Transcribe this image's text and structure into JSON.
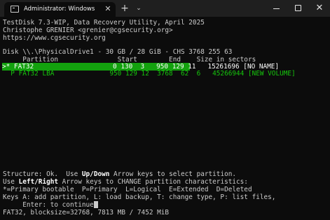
{
  "window": {
    "tab_title": "Administrator: Windows Pow",
    "tab_close": "✕",
    "new_tab": "+",
    "dropdown": "⌄",
    "minimize": "",
    "maximize": "",
    "close": "✕"
  },
  "terminal": {
    "header_1": "TestDisk 7.3-WIP, Data Recovery Utility, April 2025",
    "header_2": "Christophe GRENIER <grenier@cgsecurity.org>",
    "header_3": "https://www.cgsecurity.org",
    "disk_line": "Disk \\\\.\\PhysicalDrive1 - 30 GB / 28 GiB - CHS 3768 255 63",
    "columns_line": "     Partition               Start        End    Size in sectors",
    "partitions": [
      {
        "text": ">* FAT32                    0 130  3   950 129 11   15261696 [NO NAME]",
        "selected": true
      },
      {
        "text": "  P FAT32 LBA              950 129 12  3768  62  6   45266944 [NEW VOLUME]",
        "selected": false
      }
    ],
    "help_1_a": "Structure: Ok.  Use ",
    "help_1_b": "Up/Down",
    "help_1_c": " Arrow keys to select partition.",
    "help_2_a": "Use ",
    "help_2_b": "Left/Right",
    "help_2_c": " Arrow keys to CHANGE partition characteristics:",
    "help_3": "*=Primary bootable  P=Primary  L=Logical  E=Extended  D=Deleted",
    "help_4": "Keys A: add partition, L: load backup, T: change type, P: list files,",
    "help_5": "     Enter: to continue",
    "status_line": "FAT32, blocksize=32768, 7813 MB / 7452 MiB"
  },
  "colors": {
    "background": "#0c0c0c",
    "text": "#cccccc",
    "highlight_bg": "#13a10e",
    "highlight_fg": "#ffffff",
    "green_text": "#16c60c",
    "titlebar": "#1f1f1f"
  }
}
